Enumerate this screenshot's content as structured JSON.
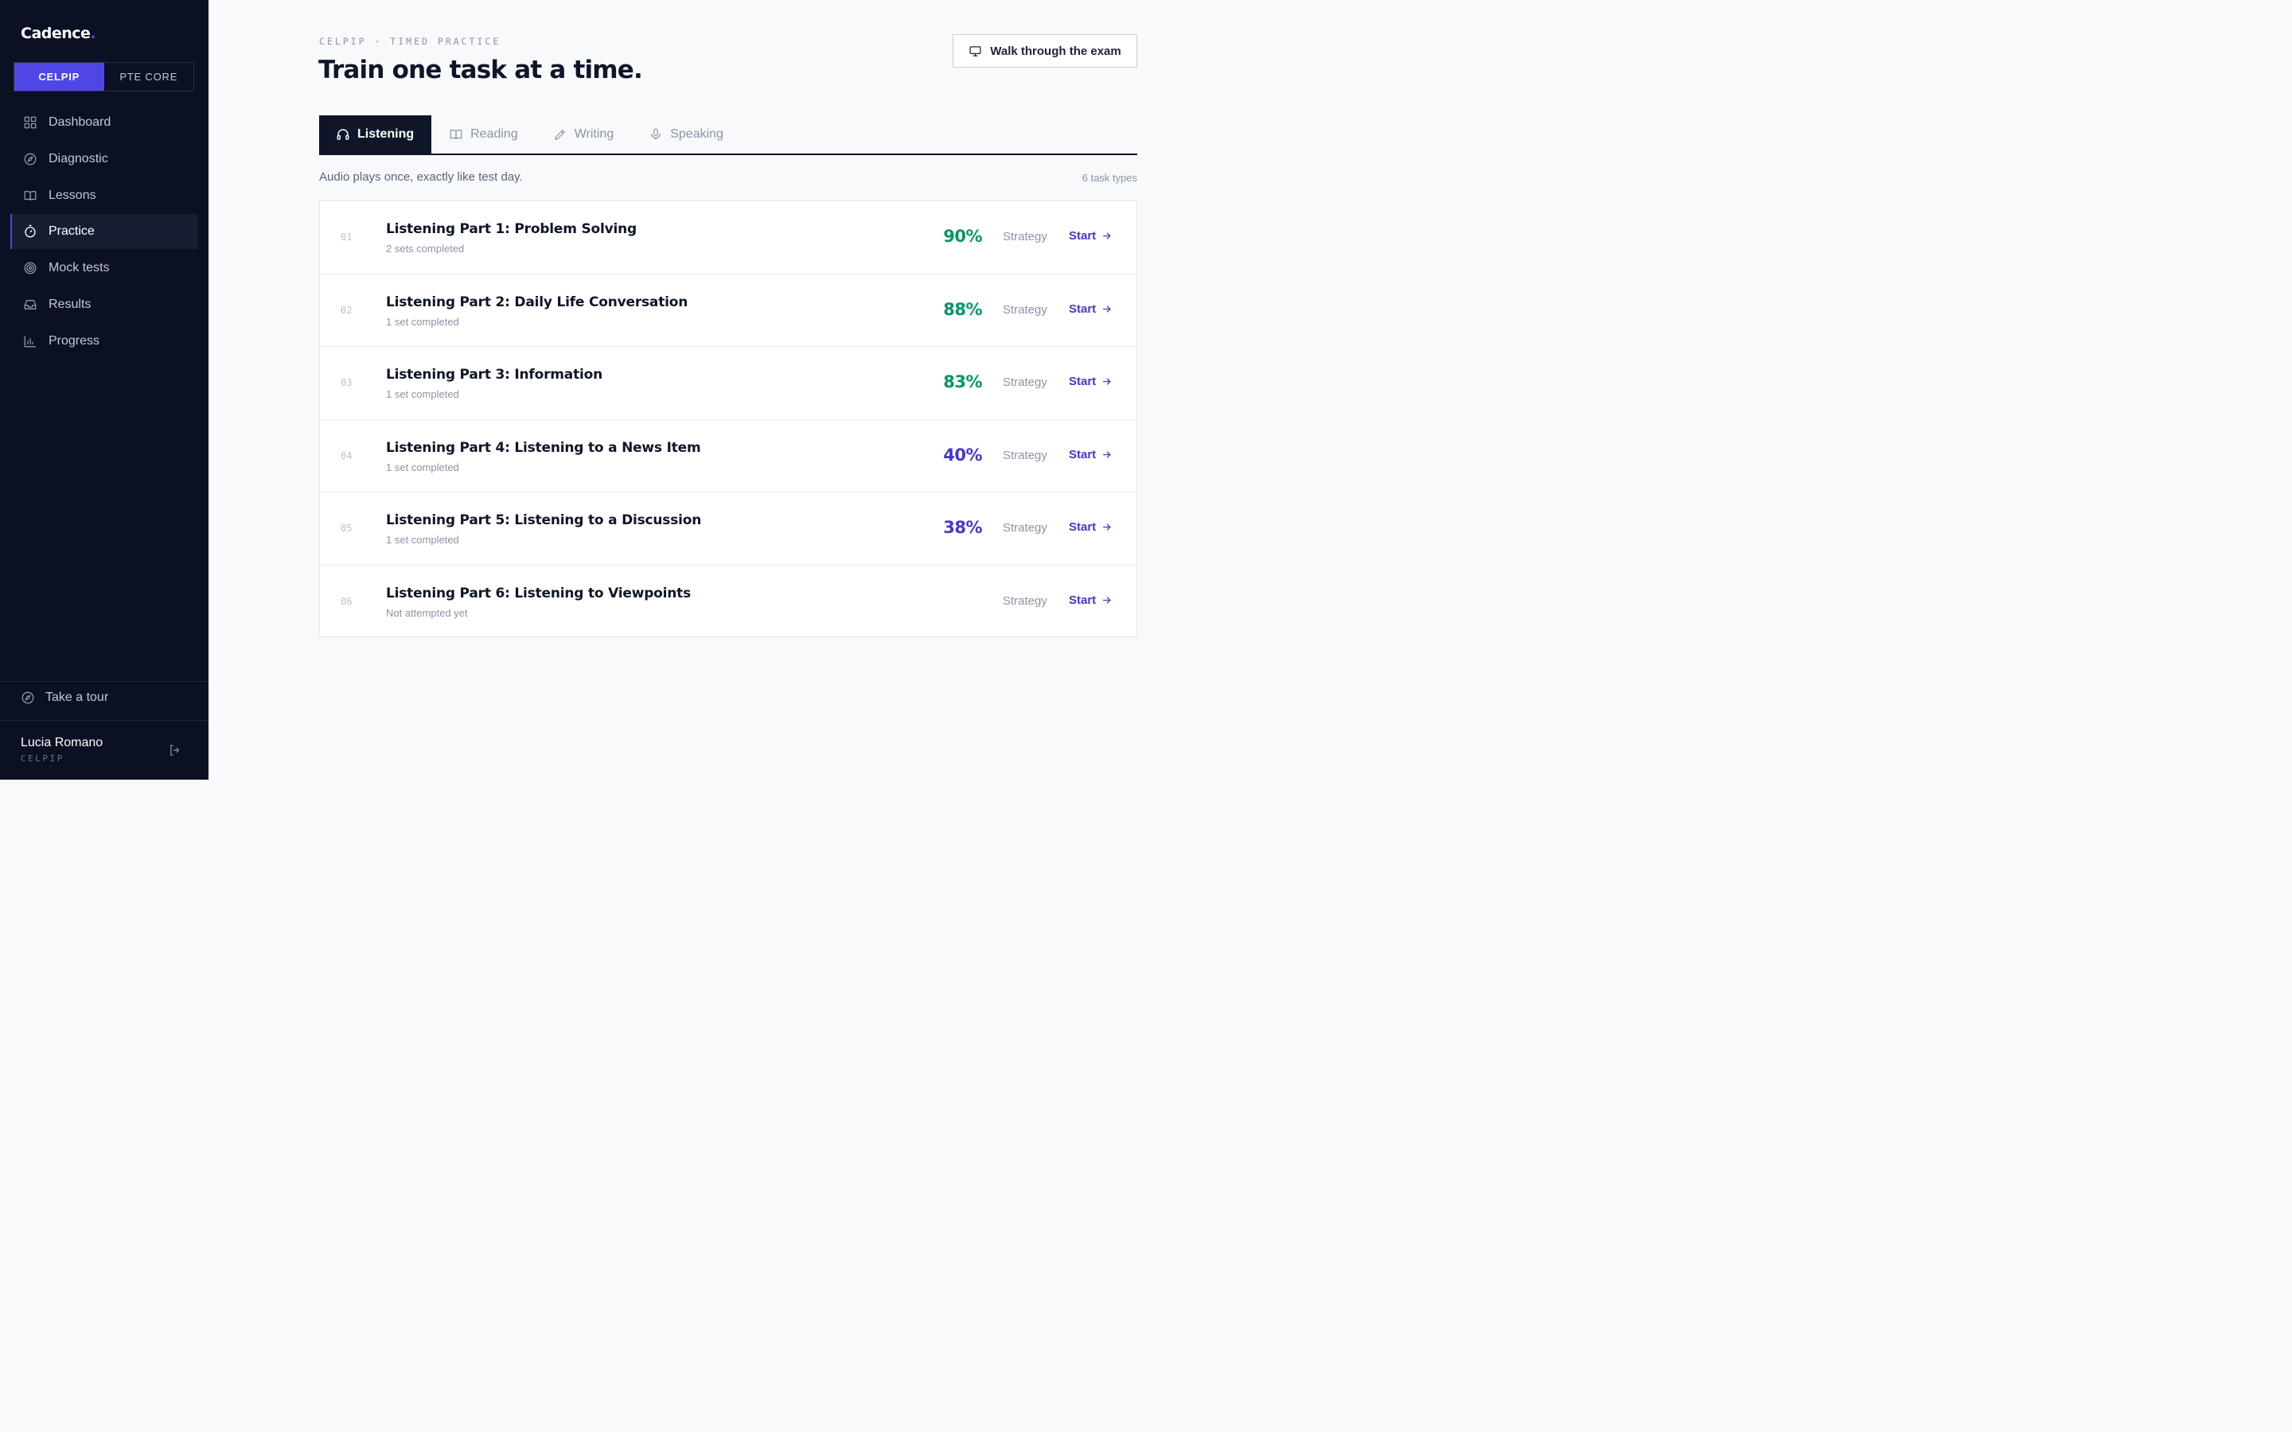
{
  "brand": {
    "name": "Cadence",
    "dot": "."
  },
  "exam_switch": [
    {
      "label": "CELPIP",
      "active": true
    },
    {
      "label": "PTE CORE",
      "active": false
    }
  ],
  "nav": [
    {
      "label": "Dashboard",
      "icon": "grid-icon"
    },
    {
      "label": "Diagnostic",
      "icon": "compass-icon"
    },
    {
      "label": "Lessons",
      "icon": "book-icon"
    },
    {
      "label": "Practice",
      "icon": "stopwatch-icon",
      "active": true
    },
    {
      "label": "Mock tests",
      "icon": "target-icon"
    },
    {
      "label": "Results",
      "icon": "inbox-icon"
    },
    {
      "label": "Progress",
      "icon": "bar-chart-icon"
    }
  ],
  "footer": {
    "tour_label": "Take a tour",
    "user_name": "Lucia Romano",
    "user_exam": "CELPIP"
  },
  "header": {
    "eyebrow": "CELPIP · TIMED PRACTICE",
    "title": "Train one task at a time.",
    "walk_button": "Walk through the exam"
  },
  "tabs": [
    {
      "label": "Listening",
      "icon": "headphones-icon",
      "active": true
    },
    {
      "label": "Reading",
      "icon": "book-open-icon"
    },
    {
      "label": "Writing",
      "icon": "pencil-icon"
    },
    {
      "label": "Speaking",
      "icon": "microphone-icon"
    }
  ],
  "section": {
    "description": "Audio plays once, exactly like test day.",
    "count": "6 task types"
  },
  "tasks": [
    {
      "num": "01",
      "name": "Listening Part 1: Problem Solving",
      "sub": "2 sets completed",
      "score": "90%",
      "level": "good",
      "strategy": "Strategy",
      "start": "Start"
    },
    {
      "num": "02",
      "name": "Listening Part 2: Daily Life Conversation",
      "sub": "1 set completed",
      "score": "88%",
      "level": "good",
      "strategy": "Strategy",
      "start": "Start"
    },
    {
      "num": "03",
      "name": "Listening Part 3: Information",
      "sub": "1 set completed",
      "score": "83%",
      "level": "good",
      "strategy": "Strategy",
      "start": "Start"
    },
    {
      "num": "04",
      "name": "Listening Part 4: Listening to a News Item",
      "sub": "1 set completed",
      "score": "40%",
      "level": "low",
      "strategy": "Strategy",
      "start": "Start"
    },
    {
      "num": "05",
      "name": "Listening Part 5: Listening to a Discussion",
      "sub": "1 set completed",
      "score": "38%",
      "level": "low",
      "strategy": "Strategy",
      "start": "Start"
    },
    {
      "num": "06",
      "name": "Listening Part 6: Listening to Viewpoints",
      "sub": "Not attempted yet",
      "score": "",
      "level": "none",
      "strategy": "Strategy",
      "start": "Start"
    }
  ],
  "colors": {
    "sidebar_bg": "#0b1023",
    "accent": "#4f46e5",
    "score_good": "#059669",
    "score_low": "#4338ca"
  }
}
